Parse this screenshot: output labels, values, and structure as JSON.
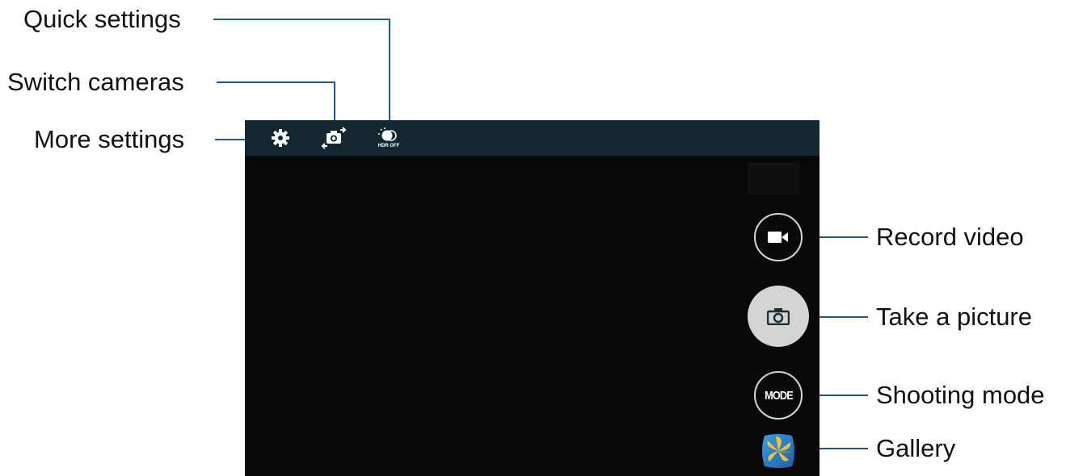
{
  "callouts": {
    "quick_settings": "Quick settings",
    "switch_cameras": "Switch cameras",
    "more_settings": "More settings",
    "record_video": "Record video",
    "take_picture": "Take a picture",
    "shooting_mode": "Shooting mode",
    "gallery": "Gallery"
  },
  "topbar": {
    "icons": [
      "gear-icon",
      "switch-camera-icon",
      "hdr-icon"
    ],
    "hdr_label": "HDR OFF"
  },
  "controls": {
    "mode_label": "MODE",
    "icons": [
      "video-camera-icon",
      "camera-icon",
      "gallery-icon"
    ]
  },
  "colors": {
    "topbar": "#142630",
    "viewfinder": "#080808",
    "leader_line": "#1a5c93",
    "capture_button": "#d4d4d4"
  }
}
